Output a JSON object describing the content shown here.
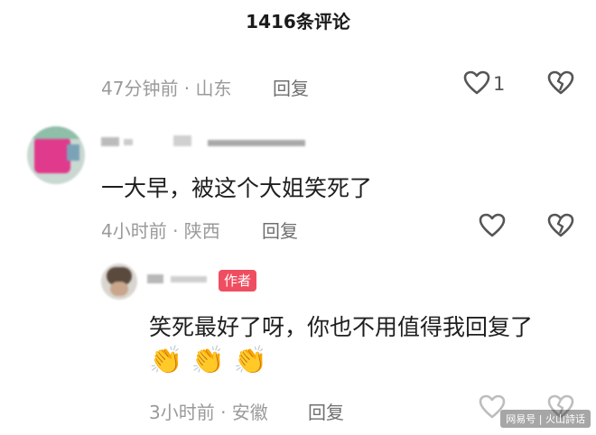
{
  "header": {
    "title": "1416条评论"
  },
  "comments": [
    {
      "meta": "47分钟前 · 山东",
      "reply": "回复",
      "likes": "1"
    },
    {
      "text": "一大早，被这个大姐笑死了",
      "meta": "4小时前 · 陕西",
      "reply": "回复"
    }
  ],
  "author_reply": {
    "badge": "作者",
    "text": "笑死最好了呀，你也不用值得我回复了",
    "emoji": [
      "👏",
      "👏",
      "👏"
    ],
    "meta": "3小时前 · 安徽",
    "reply": "回复"
  },
  "watermark": "网易号 | 火山詩话"
}
